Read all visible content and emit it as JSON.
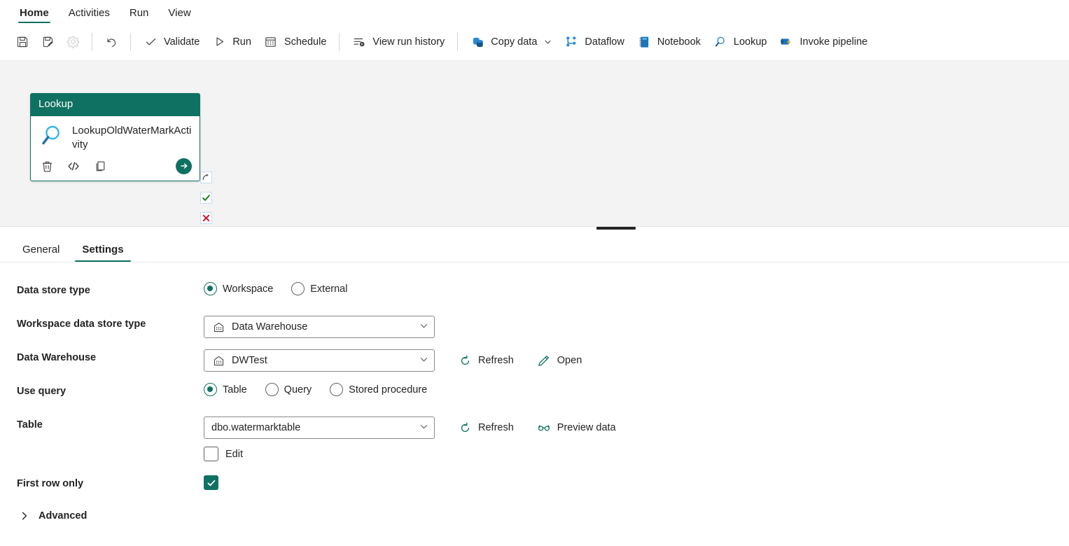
{
  "ribbon": {
    "tabs": [
      {
        "label": "Home",
        "active": true
      },
      {
        "label": "Activities",
        "active": false
      },
      {
        "label": "Run",
        "active": false
      },
      {
        "label": "View",
        "active": false
      }
    ]
  },
  "toolbar": {
    "save_label": "",
    "save_as_label": "",
    "settings_label": "",
    "undo_label": "",
    "validate_label": "Validate",
    "run_label": "Run",
    "schedule_label": "Schedule",
    "view_run_history_label": "View run history",
    "copy_data_label": "Copy data",
    "dataflow_label": "Dataflow",
    "notebook_label": "Notebook",
    "lookup_label": "Lookup",
    "invoke_pipeline_label": "Invoke pipeline"
  },
  "canvas": {
    "node": {
      "header": "Lookup",
      "name": "LookupOldWaterMarkActivity",
      "header_color": "#0f7161",
      "actions": [
        "delete-icon",
        "code-icon",
        "copy-icon",
        "run-icon"
      ],
      "handles": [
        "on-skip",
        "on-success",
        "on-fail",
        "on-completion"
      ]
    }
  },
  "detail": {
    "tabs": [
      {
        "label": "General",
        "active": false
      },
      {
        "label": "Settings",
        "active": true
      }
    ]
  },
  "settings": {
    "data_store_type": {
      "label": "Data store type",
      "options": [
        {
          "label": "Workspace",
          "checked": true
        },
        {
          "label": "External",
          "checked": false
        }
      ]
    },
    "workspace_data_store_type": {
      "label": "Workspace data store type",
      "value": "Data Warehouse",
      "icon": "warehouse-icon"
    },
    "data_warehouse": {
      "label": "Data Warehouse",
      "value": "DWTest",
      "icon": "warehouse-icon",
      "refresh_label": "Refresh",
      "open_label": "Open"
    },
    "use_query": {
      "label": "Use query",
      "options": [
        {
          "label": "Table",
          "checked": true
        },
        {
          "label": "Query",
          "checked": false
        },
        {
          "label": "Stored procedure",
          "checked": false
        }
      ]
    },
    "table": {
      "label": "Table",
      "value": "dbo.watermarktable",
      "refresh_label": "Refresh",
      "preview_label": "Preview data",
      "edit_label": "Edit",
      "edit_checked": false
    },
    "first_row_only": {
      "label": "First row only",
      "checked": true
    },
    "advanced": {
      "label": "Advanced",
      "expanded": false
    }
  },
  "colors": {
    "accent": "#0f7161",
    "canvas_bg": "#f3f3f3",
    "blue": "#1b75bb",
    "red": "#d13438"
  }
}
